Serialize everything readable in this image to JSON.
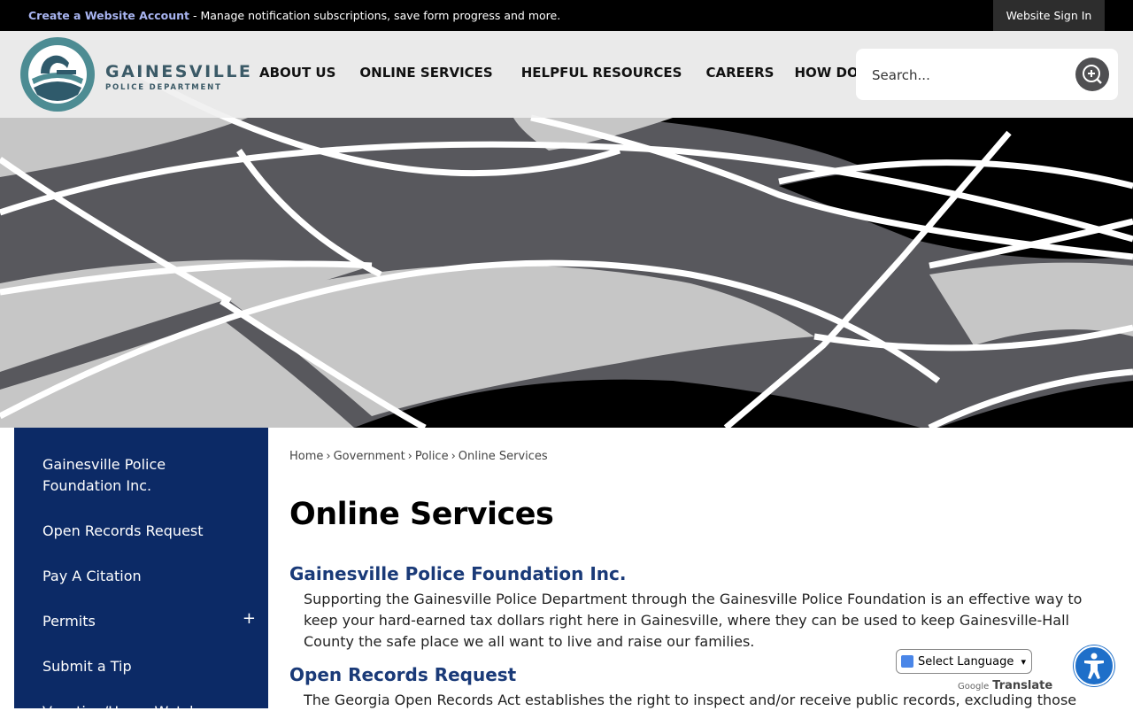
{
  "topbar": {
    "link": "Create a Website Account",
    "message": " - Manage notification subscriptions, save form progress and more.",
    "signin": "Website Sign In"
  },
  "logo": {
    "name": "GAINESVILLE",
    "sub": "POLICE DEPARTMENT"
  },
  "nav": [
    "ABOUT US",
    "ONLINE SERVICES",
    "HELPFUL RESOURCES",
    "CAREERS",
    "HOW DO I..."
  ],
  "search": {
    "placeholder": "Search..."
  },
  "sidebar": {
    "items": [
      "Gainesville Police Foundation Inc.",
      "Open Records Request",
      "Pay A Citation",
      "Permits",
      "Submit a Tip",
      "Vacation/Home Watch"
    ],
    "expand": "+"
  },
  "breadcrumb": [
    "Home",
    "Government",
    "Police",
    "Online Services"
  ],
  "breadcrumb_sep": "›",
  "page_title": "Online Services",
  "sections": [
    {
      "title": "Gainesville Police Foundation Inc.",
      "body": "Supporting the Gainesville Police Department through the Gainesville Police Foundation is an effective way to keep your hard-earned tax dollars right here in Gainesville, where they can be used to keep Gainesville-Hall County the safe place we all want to live and raise our families."
    },
    {
      "title": "Open Records Request",
      "body": "The Georgia Open Records Act establishes the right to inspect and/or receive public records, excluding those"
    }
  ],
  "translate": {
    "select_label": "Select Language",
    "powered_by": "Google",
    "translate_label": "Translate"
  },
  "colors": {
    "sidebar": "#0c2a66",
    "section_title": "#1a3a78",
    "topbar": "#000000",
    "accessibility": "#1e6fc9"
  }
}
